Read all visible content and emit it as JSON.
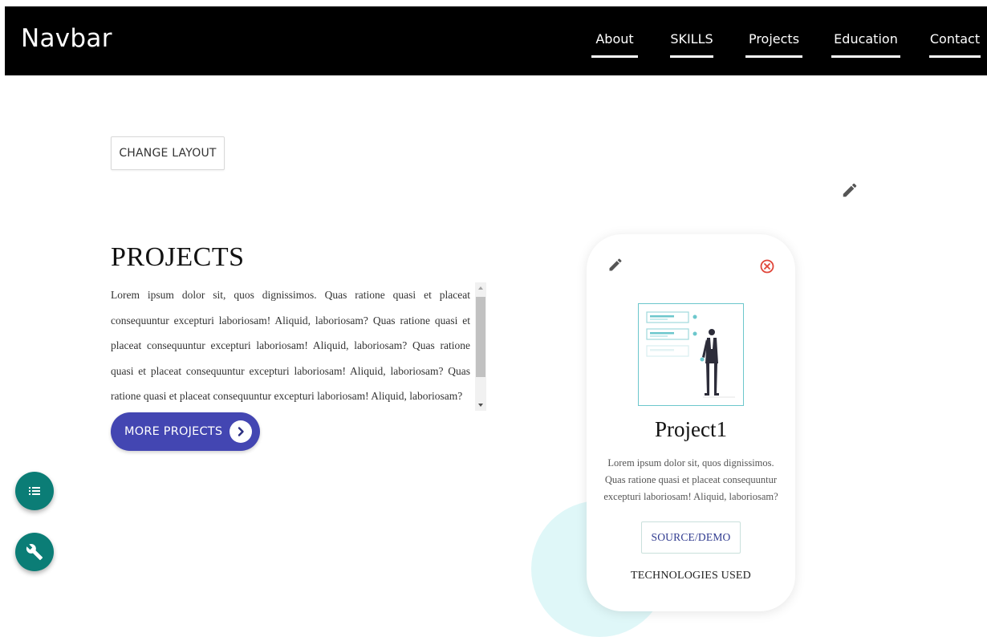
{
  "navbar": {
    "brand": "Navbar",
    "links": [
      "About",
      "SKILLS",
      "Projects",
      "Education",
      "Contact"
    ]
  },
  "toolbar": {
    "change_layout_label": "CHANGE LAYOUT"
  },
  "projects": {
    "title": "PROJECTS",
    "description": "Lorem ipsum dolor sit, quos dignissimos. Quas ratione quasi et placeat consequuntur excepturi laboriosam! Aliquid, laboriosam? Quas ratione quasi et placeat consequuntur excepturi laboriosam! Aliquid, laboriosam? Quas ratione quasi et placeat consequuntur excepturi laboriosam! Aliquid, laboriosam? Quas ratione quasi et placeat consequuntur excepturi laboriosam! Aliquid, laboriosam?",
    "more_button_label": "MORE PROJECTS"
  },
  "card": {
    "title": "Project1",
    "description": "Lorem ipsum dolor sit, quos dignissimos. Quas ratione quasi et placeat consequuntur excepturi laboriosam! Aliquid, laboriosam?",
    "source_demo_label": "SOURCE/DEMO",
    "technologies_label": "TECHNOLOGIES USED"
  },
  "icons": {
    "edit": "pencil-icon",
    "close": "close-circle-icon",
    "list": "list-icon",
    "tools": "wrench-icon",
    "chevron": "chevron-right-icon"
  },
  "colors": {
    "navbar_bg": "#000000",
    "primary_button": "#4346b2",
    "fab": "#0b7d76",
    "close_icon": "#e0463a",
    "accent_teal": "#6cc7cc"
  }
}
